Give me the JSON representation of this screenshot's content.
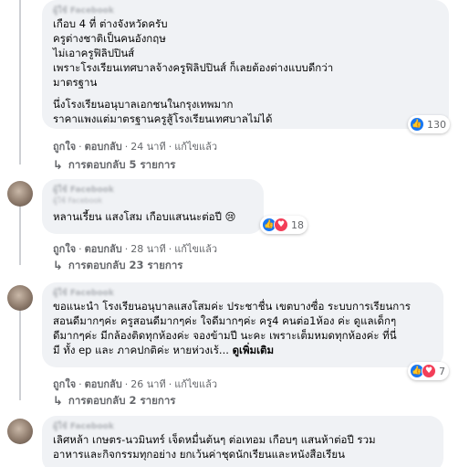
{
  "comments": [
    {
      "author": "ผู้ใช้ Facebook",
      "lines": [
        "เกือบ 4 ที่ ต่างจังหวัดครับ",
        "ครูต่างชาติเป็นคนอังกฤษ",
        "ไม่เอาครูฟิลิปปินส์",
        "เพราะโรงเรียนเทศบาลจ้างครูฟิลิปปินส์ ก็เลยต้องต่างแบบดีกว่า",
        "มาตรฐาน",
        "",
        "นึ่งโรงเรียนอนุบาลเอกชนในกรุงเทพมาก",
        "ราคาแพงแต่มาตรฐานครูสู้โรงเรียนเทศบาลไม่ได้"
      ],
      "reaction_count": "130",
      "actions": {
        "like": "ถูกใจ",
        "reply": "ตอบกลับ",
        "time": "24 นาที",
        "edited": "แก้ไขแล้ว"
      },
      "replies_label": "การตอบกลับ 5 รายการ"
    },
    {
      "author": "ผู้ใช้ Facebook",
      "subauthor": "ผู้ใช้ Facebook",
      "lines": [
        "หลานเรี้ยน แสงโสม เกือบแสนนะต่อปี 😢"
      ],
      "reaction_count": "18",
      "actions": {
        "like": "ถูกใจ",
        "reply": "ตอบกลับ",
        "time": "28 นาที",
        "edited": "แก้ไขแล้ว"
      },
      "replies_label": "การตอบกลับ 23 รายการ"
    },
    {
      "author": "ผู้ใช้ Facebook",
      "lines": [
        "ขอแนะนำ โรงเรียนอนุบาลแสงโสมค่ะ ประชาชื่น เขตบางซื่อ ระบบการเรียนการ",
        "สอนดีมากๆค่ะ ครูสอนดีมากๆค่ะ ใจดีมากๆค่ะ ครู4 คนต่อ1ห้อง ค่ะ ดูแลเด็กๆ",
        "ดีมากๆค่ะ มีกล้องติดทุกห้องค่ะ จองข้ามปี นะคะ เพราะเต็มหมดทุกห้องค่ะ ที่นี่",
        "มี ทั้ง ep และ ภาคปกติค่ะ หายห่วงเร้..."
      ],
      "see_more": "ดูเพิ่มเติม",
      "reaction_count": "7",
      "actions": {
        "like": "ถูกใจ",
        "reply": "ตอบกลับ",
        "time": "26 นาที",
        "edited": "แก้ไขแล้ว"
      },
      "replies_label": "การตอบกลับ 2 รายการ"
    },
    {
      "author": "ผู้ใช้ Facebook",
      "lines": [
        "เลิศหล้า เกษตร-นวมินทร์ เจ็ดหมื่นต้นๆ ต่อเทอม เกือบๆ แสนห้าต่อปี รวม",
        "อาหารและกิจกรรมทุกอย่าง ยกเว้นค่าชุดนักเรียนและหนังสือเรียน"
      ]
    }
  ],
  "separator": "·",
  "colors": {
    "bubble": "#f0f2f5",
    "like": "#1877f2",
    "love": "#f33e58",
    "meta": "#65676b"
  }
}
